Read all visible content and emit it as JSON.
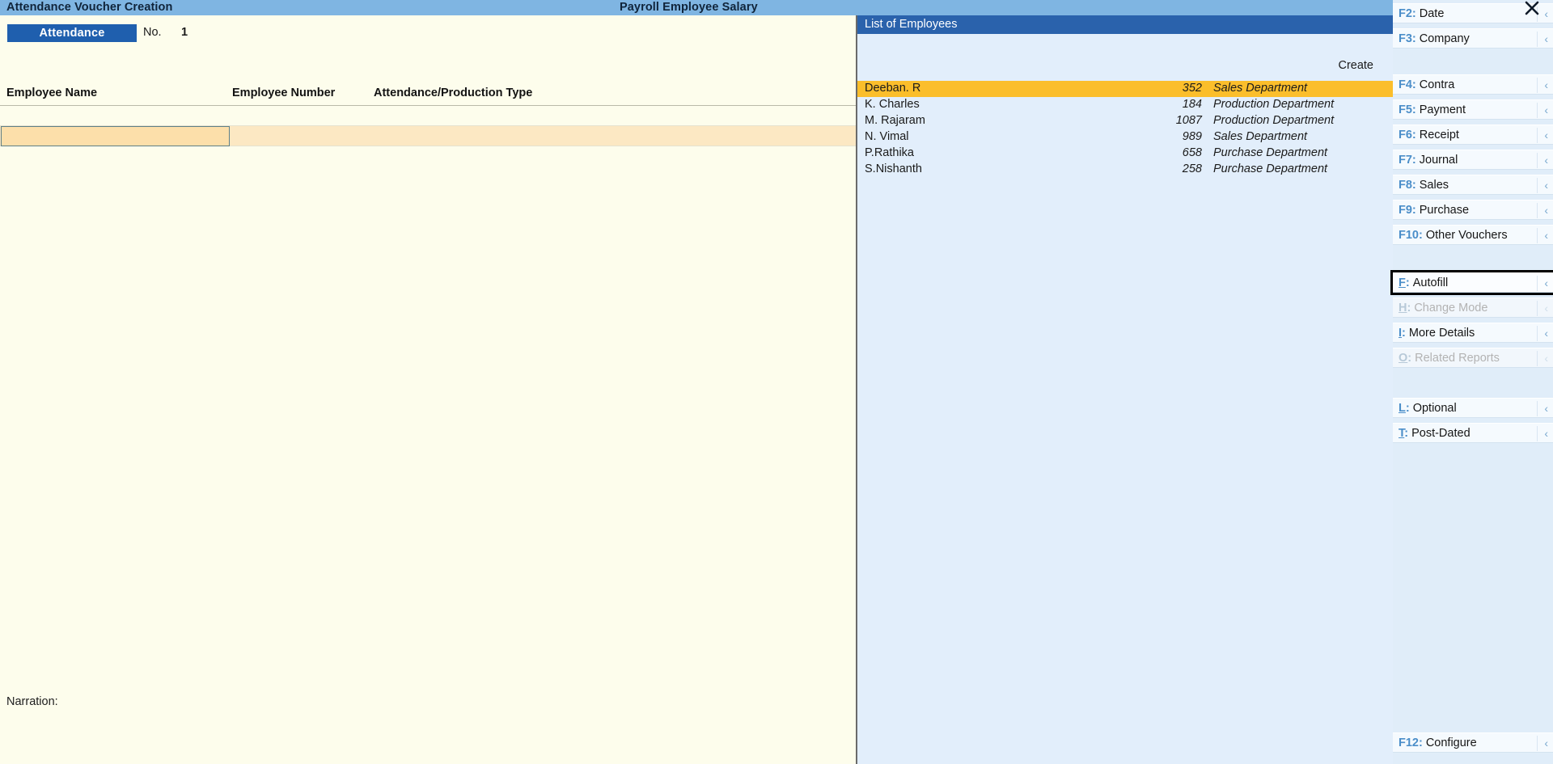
{
  "window": {
    "title": "Attendance Voucher Creation",
    "subtitle": "Payroll Employee Salary",
    "close_icon": "close-icon"
  },
  "voucher": {
    "type_tag": "Attendance",
    "no_label": "No.",
    "no_value": "1",
    "columns": {
      "employee_name": "Employee Name",
      "employee_number": "Employee Number",
      "attendance_type": "Attendance/Production Type"
    },
    "row": {
      "employee_name_value": "",
      "employee_name_placeholder": ""
    },
    "narration_label": "Narration:"
  },
  "employee_panel": {
    "title": "List of Employees",
    "create_label": "Create",
    "selected_index": 0,
    "rows": [
      {
        "name": "Deeban. R",
        "number": "352",
        "department": "Sales Department"
      },
      {
        "name": "K. Charles",
        "number": "184",
        "department": "Production Department"
      },
      {
        "name": "M. Rajaram",
        "number": "1087",
        "department": "Production Department"
      },
      {
        "name": "N. Vimal",
        "number": "989",
        "department": "Sales Department"
      },
      {
        "name": "P.Rathika",
        "number": "658",
        "department": "Purchase  Department"
      },
      {
        "name": "S.Nishanth",
        "number": "258",
        "department": "Purchase  Department"
      }
    ]
  },
  "sidebar": {
    "group1": [
      {
        "key": "F2",
        "label": "Date",
        "chevron": "‹",
        "disabled": false,
        "highlighted": false,
        "underline_index": -1
      },
      {
        "key": "F3",
        "label": "Company",
        "chevron": "‹",
        "disabled": false,
        "highlighted": false,
        "underline_index": -1
      }
    ],
    "group2": [
      {
        "key": "F4",
        "label": "Contra",
        "chevron": "‹",
        "disabled": false,
        "highlighted": false,
        "underline_index": -1
      },
      {
        "key": "F5",
        "label": "Payment",
        "chevron": "‹",
        "disabled": false,
        "highlighted": false,
        "underline_index": -1
      },
      {
        "key": "F6",
        "label": "Receipt",
        "chevron": "‹",
        "disabled": false,
        "highlighted": false,
        "underline_index": -1
      },
      {
        "key": "F7",
        "label": "Journal",
        "chevron": "‹",
        "disabled": false,
        "highlighted": false,
        "underline_index": -1
      },
      {
        "key": "F8",
        "label": "Sales",
        "chevron": "‹",
        "disabled": false,
        "highlighted": false,
        "underline_index": -1
      },
      {
        "key": "F9",
        "label": "Purchase",
        "chevron": "‹",
        "disabled": false,
        "highlighted": false,
        "underline_index": -1
      },
      {
        "key": "F10",
        "label": "Other Vouchers",
        "chevron": "‹",
        "disabled": false,
        "highlighted": false,
        "underline_index": -1
      }
    ],
    "group3": [
      {
        "key": "F",
        "label": "Autofill",
        "chevron": "‹",
        "disabled": false,
        "highlighted": true,
        "underline_index": 0
      },
      {
        "key": "H",
        "label": "Change Mode",
        "chevron": "‹",
        "disabled": true,
        "highlighted": false,
        "underline_index": 0
      },
      {
        "key": "I",
        "label": "More Details",
        "chevron": "‹",
        "disabled": false,
        "highlighted": false,
        "underline_index": 0
      },
      {
        "key": "O",
        "label": "Related Reports",
        "chevron": "‹",
        "disabled": true,
        "highlighted": false,
        "underline_index": 0
      }
    ],
    "group4": [
      {
        "key": "L",
        "label": "Optional",
        "chevron": "‹",
        "disabled": false,
        "highlighted": false,
        "underline_index": 0
      },
      {
        "key": "T",
        "label": "Post-Dated",
        "chevron": "‹",
        "disabled": false,
        "highlighted": false,
        "underline_index": 0
      }
    ],
    "bottom": [
      {
        "key": "F12",
        "label": "Configure",
        "chevron": "‹",
        "disabled": false,
        "highlighted": false,
        "underline_index": -1
      }
    ]
  },
  "colors": {
    "titlebar": "#7fb5e2",
    "voucher_bg": "#fdfdec",
    "panel_bg": "#e2eefb",
    "panel_header": "#2a62ac",
    "selected_row": "#fbbe2b",
    "active_field": "#fcdfaa",
    "accent_key": "#4b8ec9",
    "sidebar_bg": "#e0edf9"
  }
}
